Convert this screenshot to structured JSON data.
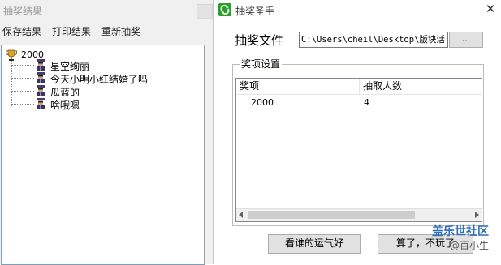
{
  "left_window": {
    "title": "抽奖结果",
    "menu": [
      "保存结果",
      "打印结果",
      "重新抽奖"
    ],
    "tree": {
      "root_label": "2000",
      "children": [
        "星空绚丽",
        "今天小明小红结婚了吗",
        "瓜蓝的",
        "啥哦嗯"
      ]
    }
  },
  "right_window": {
    "title": "抽奖圣手",
    "close_glyph": "✕",
    "file_label": "抽奖文件",
    "file_path": "C:\\Users\\cheil\\Desktop\\版块活",
    "browse_label": "...",
    "group_title": "奖项设置",
    "columns": [
      "奖项",
      "抽取人数"
    ],
    "rows": [
      {
        "prize": "2000",
        "count": "4"
      }
    ],
    "buttons": {
      "draw": "看谁的运气好",
      "quit": "算了，不玩了"
    }
  },
  "watermark": {
    "line1": "盖乐世社区",
    "line2": "@百小生"
  },
  "icons": {
    "trophy": "trophy-icon",
    "person": "person-icon",
    "app": "app-refresh-icon"
  },
  "colors": {
    "accent": "#2f6fb5",
    "trophy": "#d8a62a",
    "app_icon": "#2aa02a"
  }
}
